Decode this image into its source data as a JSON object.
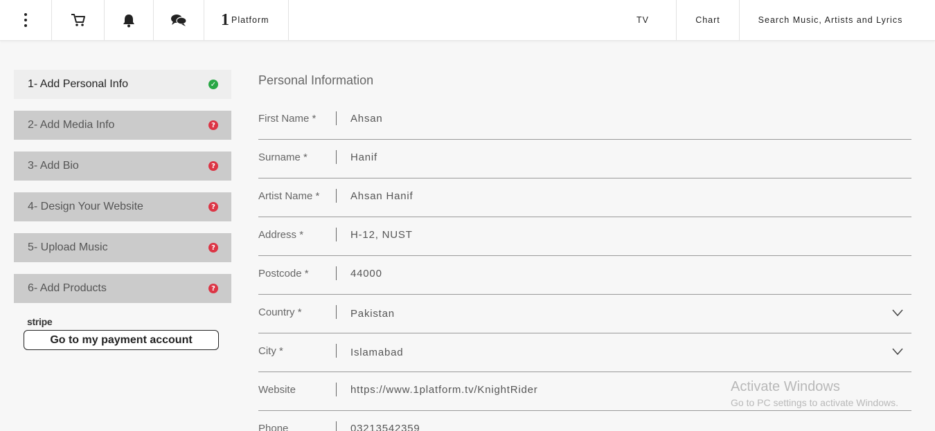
{
  "topbar": {
    "menu_icon": "vertical-dots-icon",
    "cart_icon": "cart-icon",
    "bell_icon": "bell-icon",
    "chat_icon": "chat-icon",
    "brand_mark": "1",
    "brand_text": "Platform",
    "nav": {
      "tv": "TV",
      "chart": "Chart",
      "search": "Search Music, Artists and Lyrics"
    }
  },
  "sidebar": {
    "steps": [
      {
        "label": "1- Add Personal Info",
        "status": "complete"
      },
      {
        "label": "2- Add Media Info",
        "status": "incomplete"
      },
      {
        "label": "3- Add Bio",
        "status": "incomplete"
      },
      {
        "label": "4- Design Your Website",
        "status": "incomplete"
      },
      {
        "label": "5- Upload Music",
        "status": "incomplete"
      },
      {
        "label": "6- Add Products",
        "status": "incomplete"
      }
    ],
    "stripe_label": "stripe",
    "payment_button": "Go to my payment account"
  },
  "form": {
    "title": "Personal Information",
    "fields": [
      {
        "label": "First Name *",
        "value": "Ahsan"
      },
      {
        "label": "Surname *",
        "value": "Hanif"
      },
      {
        "label": "Artist Name *",
        "value": "Ahsan Hanif"
      },
      {
        "label": "Address *",
        "value": "H-12, NUST"
      },
      {
        "label": "Postcode *",
        "value": "44000"
      },
      {
        "label": "Country *",
        "value": "Pakistan"
      },
      {
        "label": "City *",
        "value": "Islamabad"
      },
      {
        "label": "Website",
        "value": "https://www.1platform.tv/KnightRider"
      },
      {
        "label": "Phone",
        "value": "03213542359"
      }
    ]
  },
  "watermark": {
    "title": "Activate Windows",
    "subtitle": "Go to PC settings to activate Windows."
  },
  "colors": {
    "complete": "#28a745",
    "incomplete": "#dc3545",
    "active_step_bg": "#eeeeee",
    "step_bg": "#cbcbcb"
  }
}
